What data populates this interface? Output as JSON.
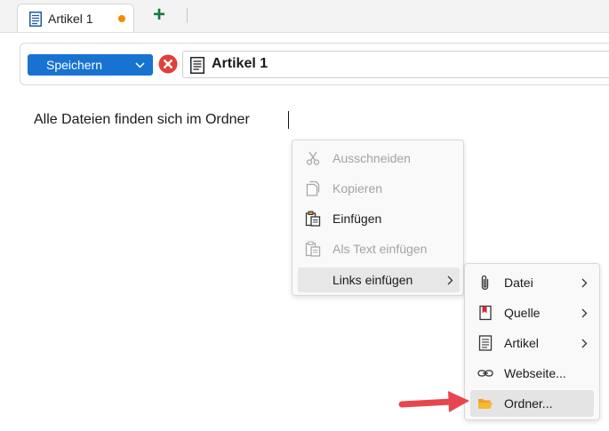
{
  "tab": {
    "label": "Artikel 1",
    "modified_dot_color": "#f08c00"
  },
  "header": {
    "save_label": "Speichern",
    "title": "Artikel 1",
    "accent": "#1872d2",
    "cancel_color": "#e0403a"
  },
  "document": {
    "text": "Alle Dateien finden sich im Ordner"
  },
  "context_menu": {
    "items": [
      {
        "label": "Ausschneiden",
        "icon": "scissors-icon",
        "enabled": false
      },
      {
        "label": "Kopieren",
        "icon": "copy-icon",
        "enabled": false
      },
      {
        "label": "Einfügen",
        "icon": "paste-icon",
        "enabled": true
      },
      {
        "label": "Als Text einfügen",
        "icon": "paste-text-icon",
        "enabled": false
      },
      {
        "label": "Links einfügen",
        "icon": "",
        "enabled": true,
        "has_submenu": true,
        "highlighted": true
      }
    ]
  },
  "submenu": {
    "items": [
      {
        "label": "Datei",
        "icon": "paperclip-icon",
        "has_submenu": true
      },
      {
        "label": "Quelle",
        "icon": "bookmark-icon",
        "has_submenu": true
      },
      {
        "label": "Artikel",
        "icon": "document-icon",
        "has_submenu": true
      },
      {
        "label": "Webseite...",
        "icon": "link-icon",
        "has_submenu": false
      },
      {
        "label": "Ordner...",
        "icon": "folder-open-icon",
        "has_submenu": false,
        "highlighted": true
      }
    ]
  },
  "annotation": {
    "arrow_color": "#e8464f"
  }
}
